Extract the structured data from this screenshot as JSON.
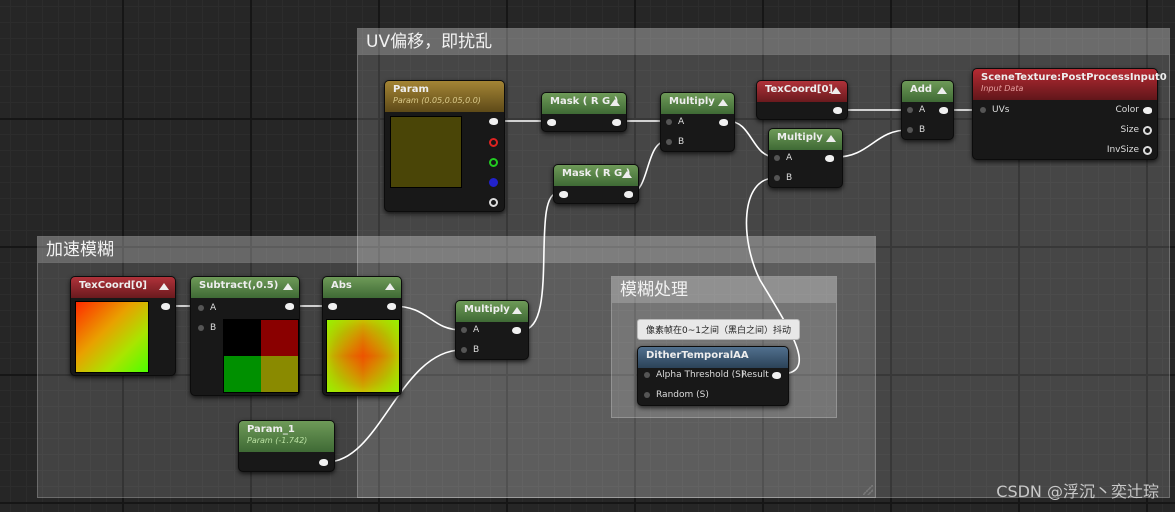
{
  "comments": {
    "uv_offset": "UV偏移，即扰乱",
    "speed_blur": "加速模糊",
    "blur_process": "模糊处理",
    "blur_note": "像素帧在0~1之间（黑白之间）抖动"
  },
  "nodes": {
    "param": {
      "title": "Param",
      "subtitle": "Param (0.05,0.05,0.0)",
      "swatch": "#4a4507"
    },
    "mask1": {
      "title": "Mask ( R G )"
    },
    "mask2": {
      "title": "Mask ( R G )"
    },
    "multiply_top": {
      "title": "Multiply",
      "pins": [
        "A",
        "B"
      ]
    },
    "texcoord_top": {
      "title": "TexCoord[0]"
    },
    "multiply_mid": {
      "title": "Multiply",
      "pins": [
        "A",
        "B"
      ]
    },
    "add": {
      "title": "Add",
      "pins": [
        "A",
        "B"
      ]
    },
    "scenetexture": {
      "title": "SceneTexture:PostProcessInput0",
      "subtitle": "Input Data",
      "input": "UVs",
      "outputs": [
        "Color",
        "Size",
        "InvSize"
      ]
    },
    "texcoord_left": {
      "title": "TexCoord[0]"
    },
    "subtract": {
      "title": "Subtract(,0.5)",
      "pins": [
        "A",
        "B"
      ]
    },
    "abs": {
      "title": "Abs"
    },
    "multiply_low": {
      "title": "Multiply",
      "pins": [
        "A",
        "B"
      ]
    },
    "param1": {
      "title": "Param_1",
      "subtitle": "Param (-1.742)"
    },
    "dither": {
      "title": "DitherTemporalAA",
      "pins": [
        "Alpha Threshold (S)",
        "Random (S)"
      ],
      "output": "Result"
    }
  },
  "watermark": "CSDN @浮沉丶奕辻琮",
  "colors": {
    "green_header": "#4f7a43",
    "red_header": "#8c232a",
    "gold_header": "#7d6524",
    "blue_header": "#3b5672"
  }
}
